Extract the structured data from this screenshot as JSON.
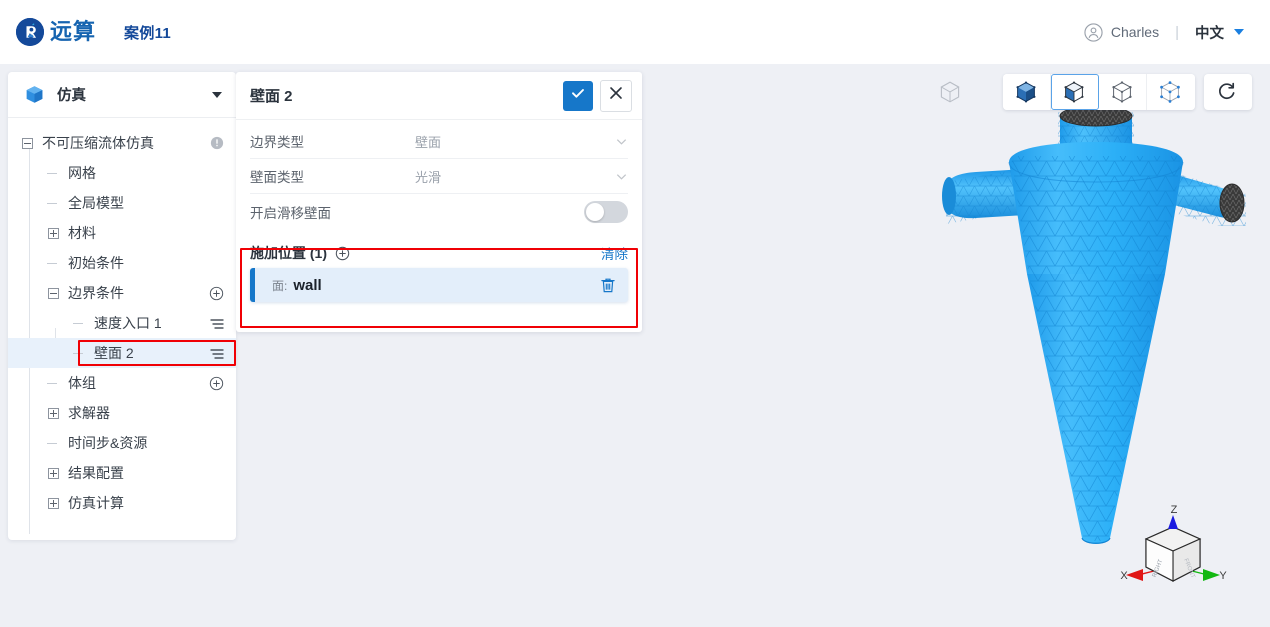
{
  "header": {
    "logo_text": "远算",
    "logo_icon": "circle-r-logo-icon",
    "project_name": "案例11",
    "user_icon": "user-avatar-icon",
    "user_name": "Charles",
    "separator": "|",
    "language": "中文",
    "caret_icon": "caret-down-icon"
  },
  "sidebar": {
    "header": {
      "icon": "cube-icon",
      "title": "仿真",
      "caret": "caret-down-icon"
    },
    "tree": [
      {
        "label": "不可压缩流体仿真",
        "toggle": "minus",
        "depth": 0,
        "tail": "info-icon",
        "selected": false
      },
      {
        "label": "网格",
        "toggle": "stem",
        "depth": 1,
        "tail": "",
        "selected": false
      },
      {
        "label": "全局模型",
        "toggle": "stem",
        "depth": 1,
        "tail": "",
        "selected": false
      },
      {
        "label": "材料",
        "toggle": "plus",
        "depth": 1,
        "tail": "",
        "selected": false
      },
      {
        "label": "初始条件",
        "toggle": "stem",
        "depth": 1,
        "tail": "",
        "selected": false
      },
      {
        "label": "边界条件",
        "toggle": "minus",
        "depth": 1,
        "tail": "plus-icon",
        "selected": false
      },
      {
        "label": "速度入口 1",
        "toggle": "stem",
        "depth": 2,
        "tail": "list-icon",
        "selected": false
      },
      {
        "label": "壁面 2",
        "toggle": "stem",
        "depth": 2,
        "tail": "list-icon",
        "selected": true
      },
      {
        "label": "体组",
        "toggle": "stem",
        "depth": 1,
        "tail": "plus-icon",
        "selected": false
      },
      {
        "label": "求解器",
        "toggle": "plus",
        "depth": 1,
        "tail": "",
        "selected": false
      },
      {
        "label": "时间步&资源",
        "toggle": "stem",
        "depth": 1,
        "tail": "",
        "selected": false
      },
      {
        "label": "结果配置",
        "toggle": "plus",
        "depth": 1,
        "tail": "",
        "selected": false
      },
      {
        "label": "仿真计算",
        "toggle": "plus",
        "depth": 1,
        "tail": "",
        "selected": false
      }
    ]
  },
  "panel": {
    "title": "壁面 2",
    "confirm_icon": "check-icon",
    "close_icon": "close-icon",
    "fields": [
      {
        "label": "边界类型",
        "value": "壁面",
        "control": "select"
      },
      {
        "label": "壁面类型",
        "value": "光滑",
        "control": "select"
      }
    ],
    "toggle_row": {
      "label": "开启滑移壁面",
      "state": "off"
    },
    "assign": {
      "title": "施加位置 (1)",
      "add_icon": "plus-circle-icon",
      "clear_label": "清除",
      "items": [
        {
          "prefix": "面:",
          "name": "wall",
          "delete_icon": "trash-icon"
        }
      ]
    }
  },
  "viewport": {
    "toolbar": {
      "standalone_icon": "wireframe-cube-icon",
      "buttons": [
        {
          "icon": "solid-cube-icon",
          "active": false
        },
        {
          "icon": "solid-wireframe-cube-icon",
          "active": true
        },
        {
          "icon": "wireframe-cube-icon",
          "active": false
        },
        {
          "icon": "points-cube-icon",
          "active": false
        }
      ],
      "reset_icon": "rotate-reset-icon"
    },
    "model": {
      "name": "cyclone-separator-mesh",
      "mesh_color": "#2eaaf3",
      "background_color": "#eef0f5"
    },
    "gizmo": {
      "icon": "orientation-cube-gizmo",
      "axes": [
        {
          "label": "X",
          "color": "#e01616"
        },
        {
          "label": "Y",
          "color": "#12b812"
        },
        {
          "label": "Z",
          "color": "#1a1ae0"
        }
      ],
      "face_labels": [
        "RIGHT",
        "FRONT"
      ]
    }
  },
  "highlights": {
    "color": "#f00005",
    "regions": [
      "sidebar-selected-node",
      "assign-location-section"
    ]
  }
}
